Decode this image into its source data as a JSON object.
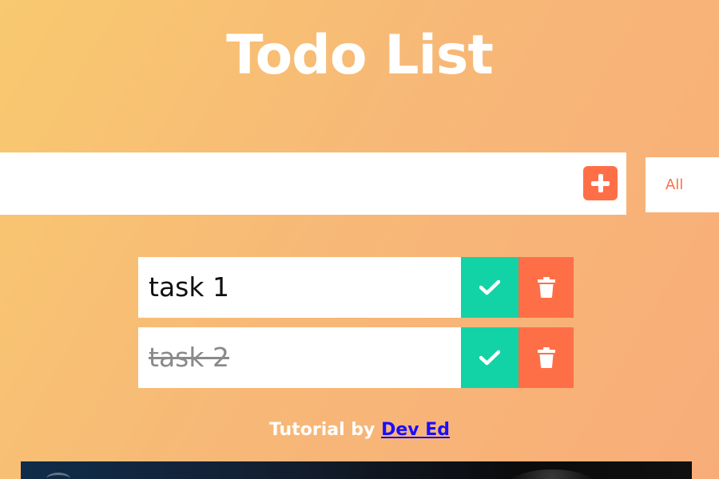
{
  "header": {
    "title": "Todo List"
  },
  "todo_form": {
    "input_value": "",
    "input_placeholder": "",
    "add_button_icon": "plus-square-icon",
    "filter": {
      "selected": "All"
    }
  },
  "todos": [
    {
      "text": "task 1",
      "completed": false
    },
    {
      "text": "task 2",
      "completed": true
    }
  ],
  "footer": {
    "credit_prefix": "Tutorial by",
    "credit_link": "Dev Ed"
  },
  "colors": {
    "accent": "#ff6f47",
    "complete": "#12d3a6",
    "link": "#1a0dff"
  }
}
